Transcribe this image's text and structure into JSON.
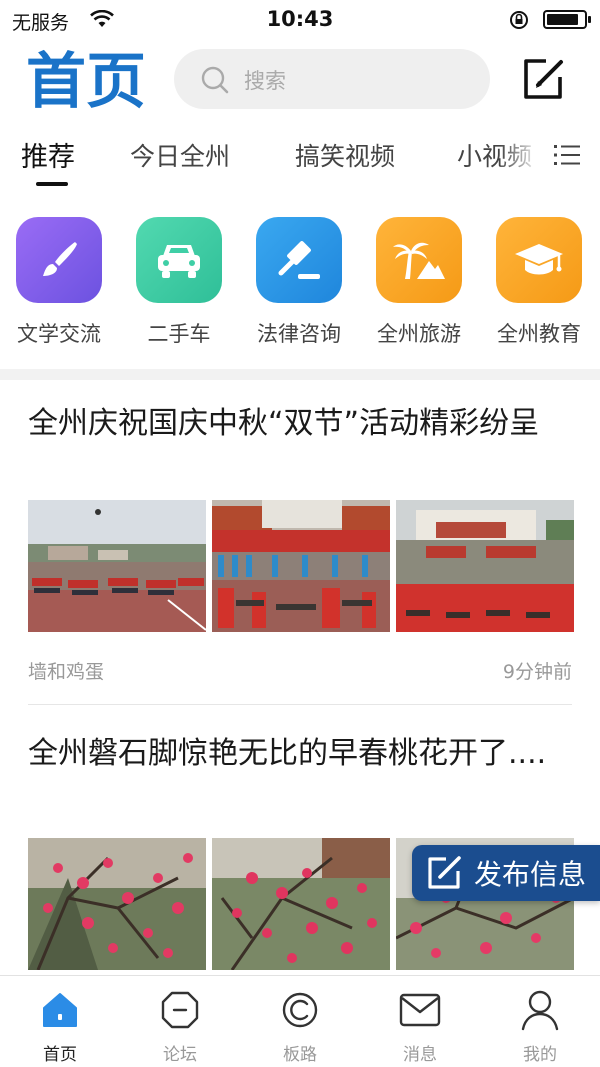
{
  "status_bar": {
    "carrier": "无服务",
    "time": "10:43",
    "battery_level": 0.85
  },
  "header": {
    "logo_text": "首页",
    "search_placeholder": "搜索"
  },
  "tabs": [
    "推荐",
    "今日全州",
    "搞笑视频",
    "小视频"
  ],
  "categories": [
    {
      "label": "文学交流",
      "icon": "brush-icon",
      "color": "#8a63ee"
    },
    {
      "label": "二手车",
      "icon": "car-icon",
      "color": "#3fcfa6"
    },
    {
      "label": "法律咨询",
      "icon": "gavel-icon",
      "color": "#2f9be6"
    },
    {
      "label": "全州旅游",
      "icon": "palm-tree-icon",
      "color": "#fba628"
    },
    {
      "label": "全州教育",
      "icon": "graduation-cap-icon",
      "color": "#fba628"
    }
  ],
  "articles": [
    {
      "title": "全州庆祝国庆中秋“双节”活动精彩纷呈",
      "source": "墙和鸡蛋",
      "time": "9分钟前"
    },
    {
      "title": "全州磐石脚惊艳无比的早春桃花开了....",
      "source": "",
      "time": ""
    }
  ],
  "publish_button": {
    "label": "发布信息"
  },
  "bottom_nav": [
    {
      "label": "首页",
      "icon": "home-icon",
      "active": true
    },
    {
      "label": "论坛",
      "icon": "forum-icon",
      "active": false
    },
    {
      "label": "板路",
      "icon": "chat-bubble-icon",
      "active": false
    },
    {
      "label": "消息",
      "icon": "mail-icon",
      "active": false
    },
    {
      "label": "我的",
      "icon": "user-icon",
      "active": false
    }
  ],
  "colors": {
    "brand_blue": "#1a73c8",
    "publish_blue": "#1b4d8f",
    "active_nav": "#2b8ce6"
  }
}
